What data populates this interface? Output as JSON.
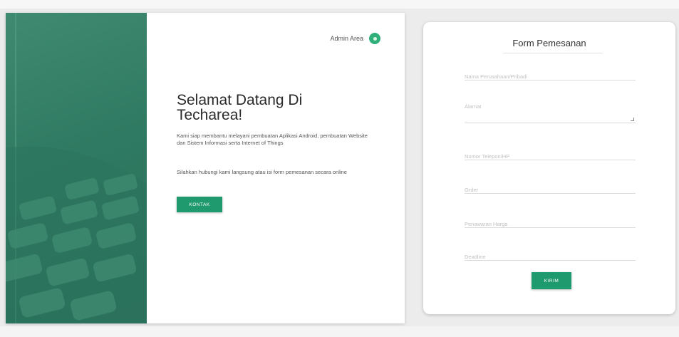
{
  "header": {
    "admin_label": "Admin Area"
  },
  "hero": {
    "title": "Selamat Datang Di Techarea!",
    "description": "Kami siap membantu melayani pembuatan Aplikasi Android, pembuatan Website dan Sistem Informasi serta Internet of Things",
    "description2": "Silahkan hubungi kami langsung atau isi form pemesanan secara online",
    "contact_button": "KONTAK"
  },
  "form": {
    "title": "Form Pemesanan",
    "fields": {
      "name_placeholder": "Nama Perusahaan/Pribadi",
      "address_placeholder": "Alamat",
      "phone_placeholder": "Nomor Telepon/HP",
      "order_placeholder": "Order",
      "price_placeholder": "Penawaran Harga",
      "deadline_placeholder": "Deadline"
    },
    "submit_button": "KIRIM"
  },
  "colors": {
    "accent": "#1f9a6e",
    "hero_image": "#2f7a62",
    "avatar": "#2fb07a"
  }
}
